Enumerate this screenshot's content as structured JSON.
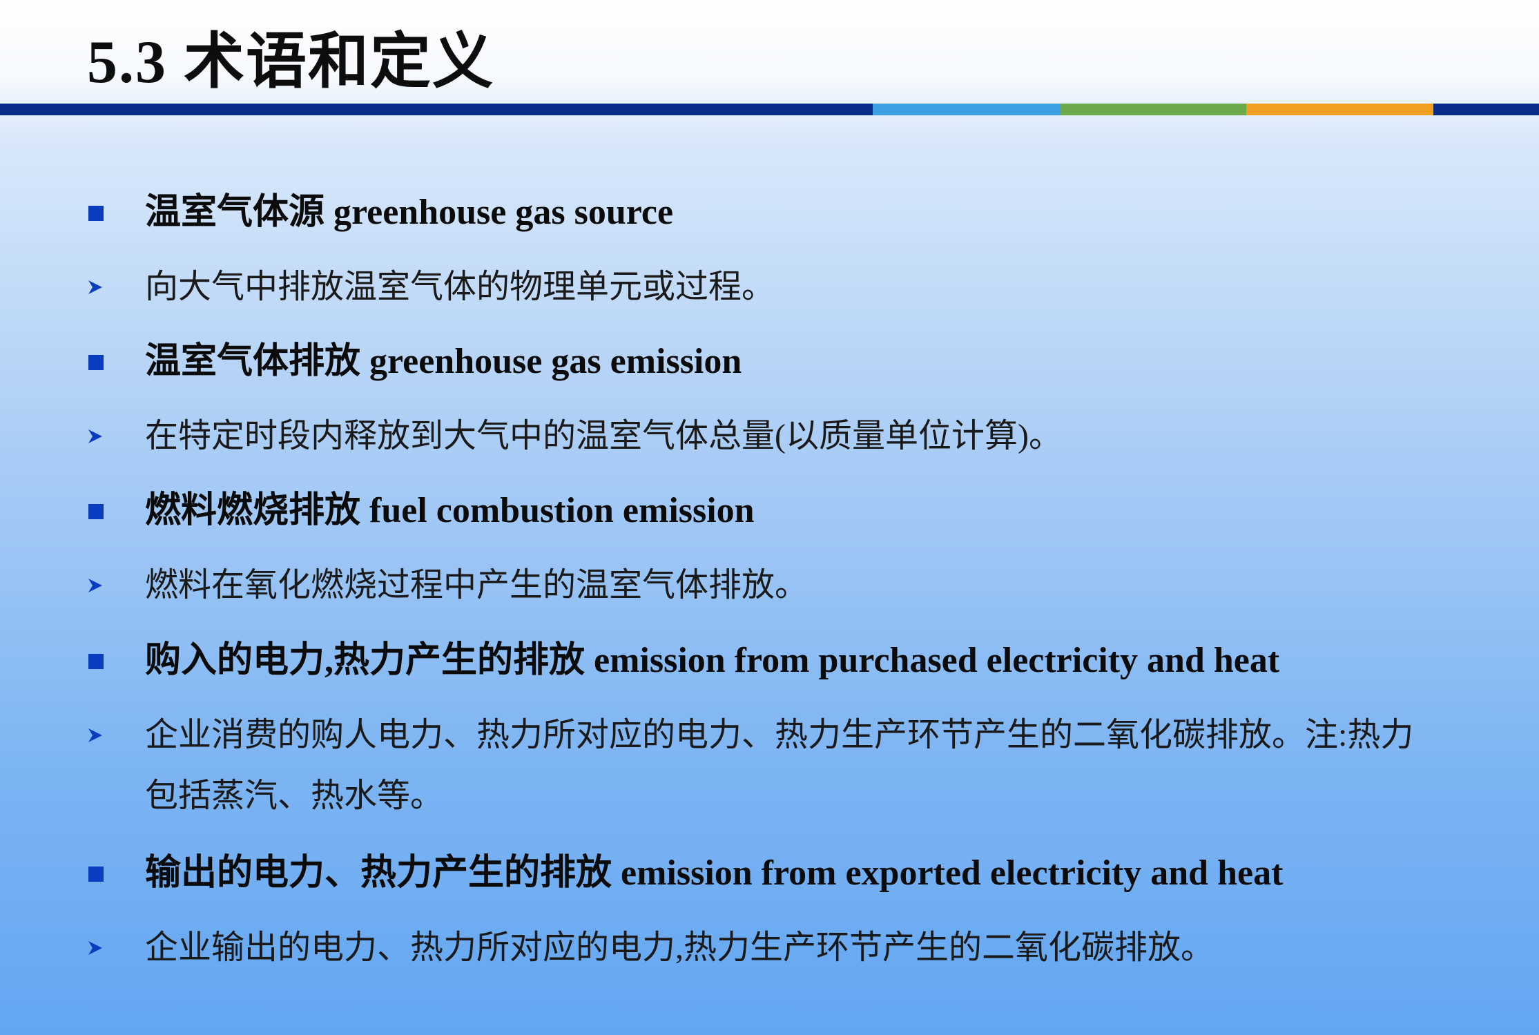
{
  "slide": {
    "title": "5.3 术语和定义",
    "colors": {
      "bar_dark_blue": "#0a2d8c",
      "bar_light_blue": "#3da0e2",
      "bar_green": "#6aaa4a",
      "bar_orange": "#f0a020",
      "bullet_blue": "#0a3cc0"
    },
    "bullet_icons": {
      "heading": "square-bullet-icon",
      "body": "chevron-right-icon"
    },
    "items": [
      {
        "term": "温室气体源  greenhouse gas source",
        "definition": "向大气中排放温室气体的物理单元或过程。"
      },
      {
        "term": "温室气体排放 greenhouse gas emission",
        "definition": "在特定时段内释放到大气中的温室气体总量(以质量单位计算)。"
      },
      {
        "term": "燃料燃烧排放 fuel combustion emission",
        "definition": "燃料在氧化燃烧过程中产生的温室气体排放。"
      },
      {
        "term": "购入的电力,热力产生的排放 emission from purchased electricity and heat",
        "definition": "企业消费的购人电力、热力所对应的电力、热力生产环节产生的二氧化碳排放。注:热力包括蒸汽、热水等。"
      },
      {
        "term": "输出的电力、热力产生的排放 emission from exported electricity and heat",
        "definition": "企业输出的电力、热力所对应的电力,热力生产环节产生的二氧化碳排放。"
      }
    ]
  }
}
